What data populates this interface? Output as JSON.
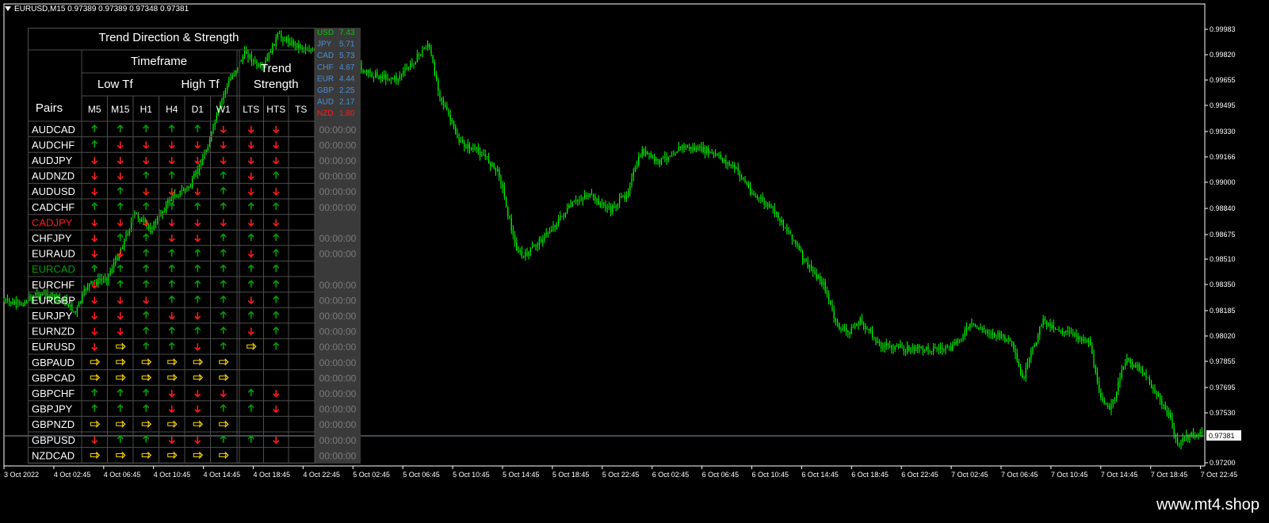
{
  "window": {
    "symbol_header": "EURUSD,M15  0.97389 0.97389 0.97348 0.97381"
  },
  "site": "www.mt4.shop",
  "price_axis": {
    "ticks": [
      "0.99983",
      "0.99820",
      "0.99655",
      "0.99495",
      "0.99330",
      "0.99166",
      "0.99000",
      "0.98840",
      "0.98675",
      "0.98510",
      "0.98350",
      "0.98185",
      "0.98020",
      "0.97855",
      "0.97695",
      "0.97530",
      "0.97200"
    ],
    "current": "0.97381"
  },
  "time_axis": [
    "3 Oct 2022",
    "4 Oct 02:45",
    "4 Oct 06:45",
    "4 Oct 10:45",
    "4 Oct 14:45",
    "4 Oct 18:45",
    "4 Oct 22:45",
    "5 Oct 02:45",
    "5 Oct 06:45",
    "5 Oct 10:45",
    "5 Oct 14:45",
    "5 Oct 18:45",
    "5 Oct 22:45",
    "6 Oct 02:45",
    "6 Oct 06:45",
    "6 Oct 10:45",
    "6 Oct 14:45",
    "6 Oct 18:45",
    "6 Oct 22:45",
    "7 Oct 02:45",
    "7 Oct 06:45",
    "7 Oct 10:45",
    "7 Oct 14:45",
    "7 Oct 18:45",
    "7 Oct 22:45"
  ],
  "colors": {
    "bull": "#00ff00",
    "up": "#00a000",
    "down": "#ff1a1a",
    "flat": "#ffd700",
    "grid": "#4d4d4d",
    "axis": "#ffffff"
  },
  "dashboard": {
    "title": "Trend Direction & Strength",
    "timeframe_label": "Timeframe",
    "low_tf": "Low Tf",
    "high_tf": "High Tf",
    "trend_strength": [
      "Trend",
      "Strength"
    ],
    "pairs_label": "Pairs",
    "tf_headers": [
      "M5",
      "M15",
      "H1",
      "H4",
      "D1",
      "W1"
    ],
    "ts_headers": [
      "LTS",
      "HTS",
      "TS"
    ],
    "currency_strength": [
      {
        "name": "USD",
        "value": "7.43",
        "color": "#00cc00"
      },
      {
        "name": "JPY",
        "value": "5.71",
        "color": "#4a8fd9"
      },
      {
        "name": "CAD",
        "value": "5.73",
        "color": "#4a8fd9"
      },
      {
        "name": "CHF",
        "value": "4.67",
        "color": "#4a8fd9"
      },
      {
        "name": "EUR",
        "value": "4.44",
        "color": "#4a8fd9"
      },
      {
        "name": "GBP",
        "value": "2.25",
        "color": "#4a8fd9"
      },
      {
        "name": "AUD",
        "value": "2.17",
        "color": "#4a8fd9"
      },
      {
        "name": "NZD",
        "value": "1.80",
        "color": "#ff1a1a"
      }
    ],
    "rows": [
      {
        "pair": "AUDCAD",
        "color": "#ffffff",
        "tf": [
          "u",
          "u",
          "u",
          "u",
          "u",
          "d"
        ],
        "lts": "d",
        "hts": "d",
        "time": "00:00:00"
      },
      {
        "pair": "AUDCHF",
        "color": "#ffffff",
        "tf": [
          "u",
          "d",
          "d",
          "d",
          "d",
          "d"
        ],
        "lts": "d",
        "hts": "d",
        "time": "00:00:00"
      },
      {
        "pair": "AUDJPY",
        "color": "#ffffff",
        "tf": [
          "d",
          "d",
          "d",
          "d",
          "d",
          "d"
        ],
        "lts": "d",
        "hts": "d",
        "time": "00:00:00"
      },
      {
        "pair": "AUDNZD",
        "color": "#ffffff",
        "tf": [
          "d",
          "d",
          "u",
          "u",
          "u",
          "u"
        ],
        "lts": "d",
        "hts": "u",
        "time": "00:00:00"
      },
      {
        "pair": "AUDUSD",
        "color": "#ffffff",
        "tf": [
          "d",
          "u",
          "d",
          "d",
          "d",
          "u"
        ],
        "lts": "d",
        "hts": "d",
        "time": "00:00:00"
      },
      {
        "pair": "CADCHF",
        "color": "#ffffff",
        "tf": [
          "u",
          "u",
          "u",
          "u",
          "u",
          "u"
        ],
        "lts": "u",
        "hts": "u",
        "time": "00:00:00"
      },
      {
        "pair": "CADJPY",
        "color": "#ff1a1a",
        "tf": [
          "d",
          "d",
          "d",
          "d",
          "d",
          "d"
        ],
        "lts": "d",
        "hts": "d",
        "time": ""
      },
      {
        "pair": "CHFJPY",
        "color": "#ffffff",
        "tf": [
          "d",
          "u",
          "u",
          "d",
          "d",
          "u"
        ],
        "lts": "u",
        "hts": "u",
        "time": "00:00:00"
      },
      {
        "pair": "EURAUD",
        "color": "#ffffff",
        "tf": [
          "d",
          "d",
          "u",
          "u",
          "u",
          "u"
        ],
        "lts": "d",
        "hts": "u",
        "time": "00:00:00"
      },
      {
        "pair": "EURCAD",
        "color": "#00a000",
        "tf": [
          "u",
          "u",
          "u",
          "u",
          "u",
          "u"
        ],
        "lts": "u",
        "hts": "u",
        "time": ""
      },
      {
        "pair": "EURCHF",
        "color": "#ffffff",
        "tf": [
          "d",
          "u",
          "u",
          "u",
          "u",
          "u"
        ],
        "lts": "u",
        "hts": "u",
        "time": "00:00:00"
      },
      {
        "pair": "EURGBP",
        "color": "#ffffff",
        "tf": [
          "d",
          "d",
          "d",
          "u",
          "u",
          "u"
        ],
        "lts": "d",
        "hts": "u",
        "time": "00:00:00"
      },
      {
        "pair": "EURJPY",
        "color": "#ffffff",
        "tf": [
          "d",
          "d",
          "u",
          "d",
          "d",
          "u"
        ],
        "lts": "u",
        "hts": "u",
        "time": "00:00:00"
      },
      {
        "pair": "EURNZD",
        "color": "#ffffff",
        "tf": [
          "d",
          "d",
          "u",
          "u",
          "u",
          "u"
        ],
        "lts": "d",
        "hts": "u",
        "time": "00:00:00"
      },
      {
        "pair": "EURUSD",
        "color": "#ffffff",
        "tf": [
          "d",
          "f",
          "u",
          "u",
          "d",
          "u"
        ],
        "lts": "f",
        "hts": "u",
        "time": "00:00:00"
      },
      {
        "pair": "GBPAUD",
        "color": "#ffffff",
        "tf": [
          "f",
          "f",
          "f",
          "f",
          "f",
          "f"
        ],
        "lts": "",
        "hts": "",
        "time": "00:00:00"
      },
      {
        "pair": "GBPCAD",
        "color": "#ffffff",
        "tf": [
          "f",
          "f",
          "f",
          "f",
          "f",
          "f"
        ],
        "lts": "",
        "hts": "",
        "time": "00:00:00"
      },
      {
        "pair": "GBPCHF",
        "color": "#ffffff",
        "tf": [
          "u",
          "u",
          "u",
          "d",
          "d",
          "d"
        ],
        "lts": "u",
        "hts": "d",
        "time": "00:00:00"
      },
      {
        "pair": "GBPJPY",
        "color": "#ffffff",
        "tf": [
          "u",
          "u",
          "u",
          "d",
          "d",
          "u"
        ],
        "lts": "u",
        "hts": "d",
        "time": "00:00:00"
      },
      {
        "pair": "GBPNZD",
        "color": "#ffffff",
        "tf": [
          "f",
          "f",
          "f",
          "f",
          "f",
          "f"
        ],
        "lts": "",
        "hts": "",
        "time": "00:00:00"
      },
      {
        "pair": "GBPUSD",
        "color": "#ffffff",
        "tf": [
          "d",
          "u",
          "u",
          "d",
          "d",
          "u"
        ],
        "lts": "u",
        "hts": "d",
        "time": "00:00:00"
      },
      {
        "pair": "NZDCAD",
        "color": "#ffffff",
        "tf": [
          "f",
          "f",
          "f",
          "f",
          "f",
          "f"
        ],
        "lts": "",
        "hts": "",
        "time": "00:00:00"
      }
    ]
  }
}
